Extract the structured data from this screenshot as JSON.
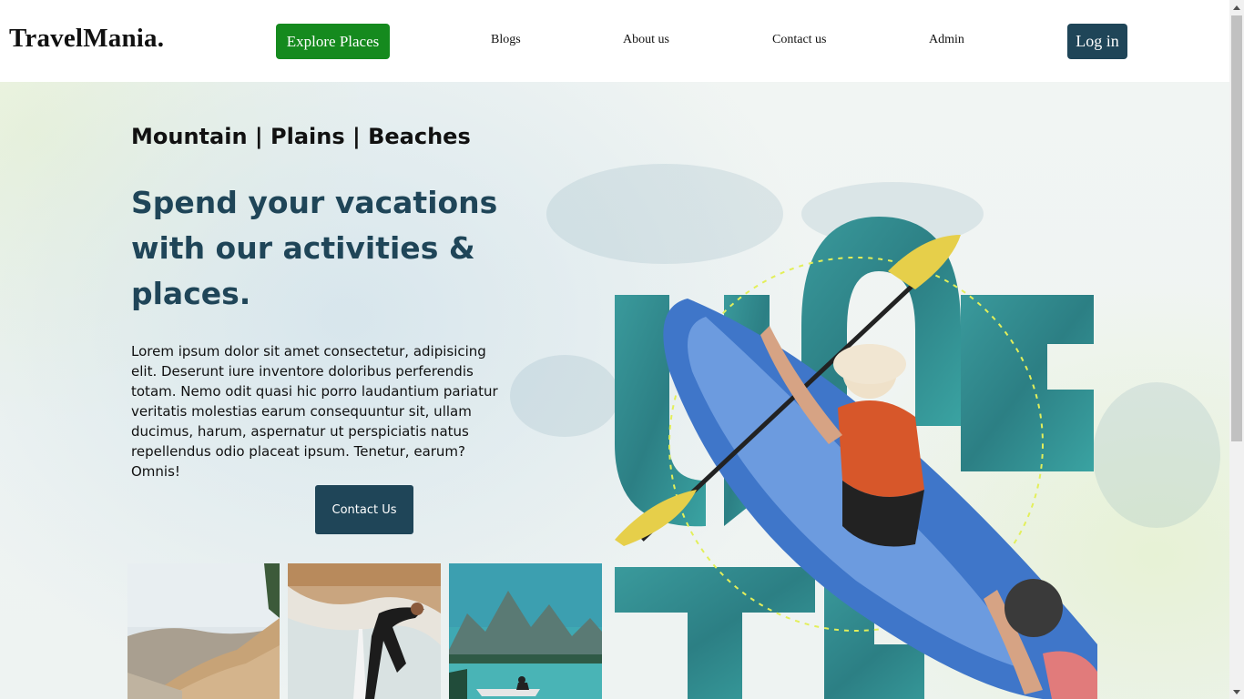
{
  "header": {
    "logo": "TravelMania.",
    "explore_label": "Explore Places",
    "nav": [
      {
        "label": "Blogs"
      },
      {
        "label": "About us"
      },
      {
        "label": "Contact us"
      },
      {
        "label": "Admin"
      }
    ],
    "login_label": "Log in"
  },
  "hero": {
    "tagline": "Mountain | Plains | Beaches",
    "headline": "Spend your vacations with our activities & places.",
    "body": "Lorem ipsum dolor sit amet consectetur, adipisicing elit. Deserunt iure inventore doloribus perferendis totam. Nemo odit quasi hic porro laudantium pariatur veritatis molestias earum consequuntur sit, ullam ducimus, harum, aspernatur ut perspiciatis natus repellendus odio placeat ipsum. Tenetur, earum? Omnis!",
    "contact_label": "Contact Us"
  },
  "colors": {
    "explore_green": "#158a1e",
    "primary_navy": "#1f4558",
    "water_teal": "#2e8a8e"
  },
  "images": {
    "thumb_1": "coastal-cliffs-photo",
    "thumb_2": "surfer-photo",
    "thumb_3": "mountain-lake-kayak-photo",
    "hero": "kayaker-water-letters-photo"
  }
}
